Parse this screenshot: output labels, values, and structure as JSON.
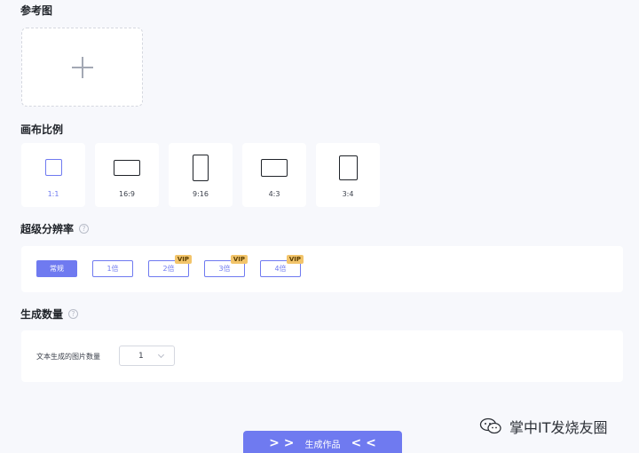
{
  "reference": {
    "title": "参考图"
  },
  "canvas": {
    "title": "画布比例",
    "ratios": [
      {
        "label": "1:1",
        "selected": true,
        "icon": "square-icon"
      },
      {
        "label": "16:9",
        "selected": false,
        "icon": "landscape-icon"
      },
      {
        "label": "9:16",
        "selected": false,
        "icon": "portrait-icon"
      },
      {
        "label": "4:3",
        "selected": false,
        "icon": "landscape-icon"
      },
      {
        "label": "3:4",
        "selected": false,
        "icon": "portrait-icon"
      }
    ]
  },
  "resolution": {
    "title": "超级分辨率",
    "help": "?",
    "options": [
      {
        "label": "常规",
        "selected": true
      },
      {
        "label": "1倍",
        "selected": false
      },
      {
        "label": "2倍",
        "selected": false,
        "badge": "VIP"
      },
      {
        "label": "3倍",
        "selected": false,
        "badge": "VIP"
      },
      {
        "label": "4倍",
        "selected": false,
        "badge": "VIP"
      }
    ]
  },
  "quantity": {
    "title": "生成数量",
    "help": "?",
    "label": "文本生成的图片数量",
    "value": "1"
  },
  "generate": {
    "label": "生成作品",
    "left_arrows": "> >",
    "right_arrows": "< <"
  },
  "watermark": {
    "text": "掌中IT发烧友圈"
  },
  "colors": {
    "accent": "#6f7af0",
    "vip": "#f2c46a"
  }
}
